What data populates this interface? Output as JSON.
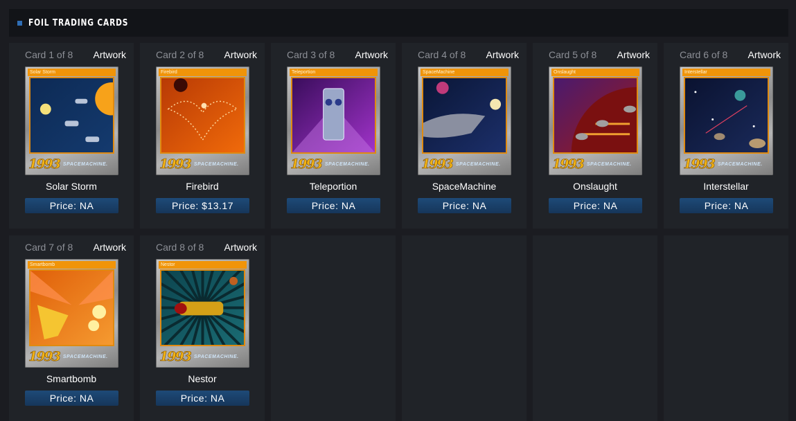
{
  "section": {
    "title": "FOIL TRADING CARDS"
  },
  "cards": [
    {
      "counter": "Card 1 of 8",
      "artwork": "Artwork",
      "title_bar": "Solar Storm",
      "name": "Solar Storm",
      "price": "Price: NA",
      "logo_year": "1993",
      "logo_brand": "SPACEMACHINE.",
      "theme": "solar-storm"
    },
    {
      "counter": "Card 2 of 8",
      "artwork": "Artwork",
      "title_bar": "Firebird",
      "name": "Firebird",
      "price": "Price: $13.17",
      "logo_year": "1993",
      "logo_brand": "SPACEMACHINE.",
      "theme": "firebird"
    },
    {
      "counter": "Card 3 of 8",
      "artwork": "Artwork",
      "title_bar": "Teleportion",
      "name": "Teleportion",
      "price": "Price: NA",
      "logo_year": "1993",
      "logo_brand": "SPACEMACHINE.",
      "theme": "teleportion"
    },
    {
      "counter": "Card 4 of 8",
      "artwork": "Artwork",
      "title_bar": "SpaceMachine",
      "name": "SpaceMachine",
      "price": "Price: NA",
      "logo_year": "1993",
      "logo_brand": "SPACEMACHINE.",
      "theme": "spacemachine"
    },
    {
      "counter": "Card 5 of 8",
      "artwork": "Artwork",
      "title_bar": "Onslaught",
      "name": "Onslaught",
      "price": "Price: NA",
      "logo_year": "1993",
      "logo_brand": "SPACEMACHINE.",
      "theme": "onslaught"
    },
    {
      "counter": "Card 6 of 8",
      "artwork": "Artwork",
      "title_bar": "Interstellar",
      "name": "Interstellar",
      "price": "Price: NA",
      "logo_year": "1993",
      "logo_brand": "SPACEMACHINE.",
      "theme": "interstellar"
    },
    {
      "counter": "Card 7 of 8",
      "artwork": "Artwork",
      "title_bar": "Smartbomb",
      "name": "Smartbomb",
      "price": "Price: NA",
      "logo_year": "1993",
      "logo_brand": "SPACEMACHINE.",
      "theme": "smartbomb"
    },
    {
      "counter": "Card 8 of 8",
      "artwork": "Artwork",
      "title_bar": "Nestor",
      "name": "Nestor",
      "price": "Price: NA",
      "logo_year": "1993",
      "logo_brand": "SPACEMACHINE.",
      "theme": "nestor"
    }
  ],
  "colors": {
    "background": "#1b1c21",
    "cell": "#202328",
    "header": "#121418",
    "accent": "#2f6eb5",
    "price_button": "#1e4a78",
    "card_titlebar": "#f09409"
  }
}
